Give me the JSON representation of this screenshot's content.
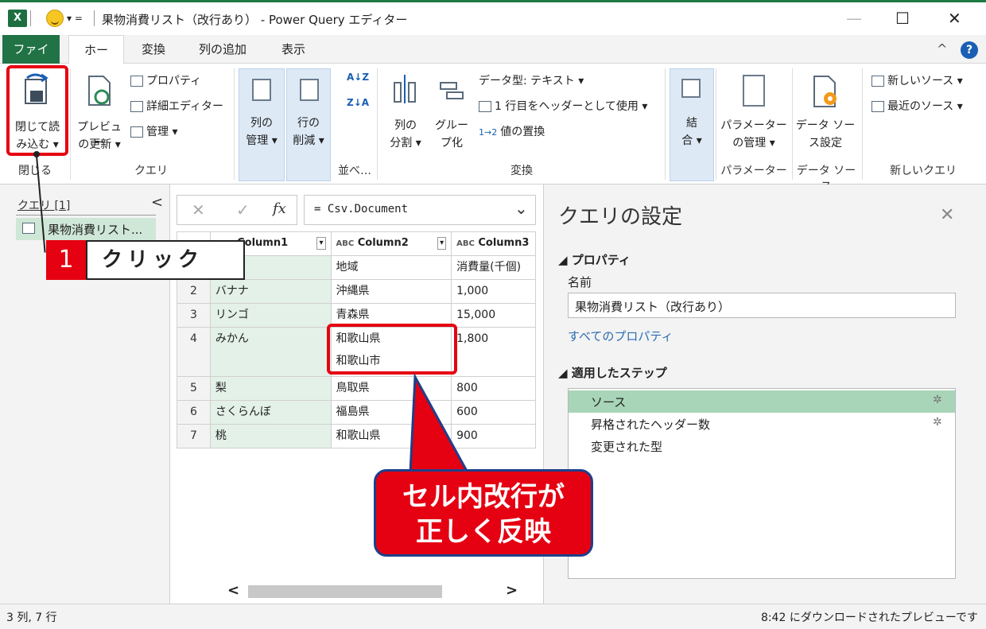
{
  "window": {
    "title": "果物消費リスト（改行あり） - Power Query エディター",
    "close_glyph": "✕",
    "maximize_glyph": "☐",
    "minimize_glyph": "—",
    "qat_arrow": "▾ ="
  },
  "tabs": [
    {
      "label": "ファイル"
    },
    {
      "label": "ホーム"
    },
    {
      "label": "変換"
    },
    {
      "label": "列の追加"
    },
    {
      "label": "表示"
    }
  ],
  "ribbon": {
    "close_load": [
      "閉じて読",
      "み込む ▾"
    ],
    "preview_refresh": [
      "プレビュー",
      "の更新 ▾"
    ],
    "properties": "プロパティ",
    "advanced_editor": "詳細エディター",
    "manage": "管理 ▾",
    "manage_columns": [
      "列の",
      "管理 ▾"
    ],
    "reduce_rows": [
      "行の",
      "削減 ▾"
    ],
    "split_column": [
      "列の",
      "分割 ▾"
    ],
    "group_by": [
      "グルー",
      "プ化"
    ],
    "data_type": "データ型: テキスト ▾",
    "use_first_row": "1 行目をヘッダーとして使用 ▾",
    "replace_values": "値の置換",
    "combine": [
      "結",
      "合 ▾"
    ],
    "manage_params": [
      "パラメーター",
      "の管理 ▾"
    ],
    "data_source_settings": [
      "データ ソー",
      "ス設定"
    ],
    "new_source": "新しいソース ▾",
    "recent_source": "最近のソース ▾",
    "groups": {
      "close": "閉じる",
      "query": "クエリ",
      "sort": "並べ…",
      "transform": "変換",
      "parameters": "パラメーター",
      "data_source": "データ ソース",
      "new_query": "新しいクエリ"
    },
    "sort_az": "A↓Z",
    "sort_za": "Z↓A"
  },
  "left_pane": {
    "header": "クエリ [1]",
    "collapse": "<",
    "query_item": "果物消費リスト..."
  },
  "formula_bar": {
    "cancel": "✕",
    "commit": "✓",
    "fx": "fx",
    "formula": "= Csv.Document",
    "dropdown": "⌄"
  },
  "grid": {
    "headers": [
      "Column1",
      "Column2",
      "Column3"
    ],
    "header_type": "ABC",
    "rows": [
      {
        "n": "1",
        "c1": "",
        "c2": "地域",
        "c3": "消費量(千個)"
      },
      {
        "n": "2",
        "c1": "バナナ",
        "c2": "沖縄県",
        "c3": "1,000"
      },
      {
        "n": "3",
        "c1": "リンゴ",
        "c2": "青森県",
        "c3": "15,000"
      },
      {
        "n": "4",
        "c1": "みかん",
        "c2": "和歌山県",
        "c2b": "和歌山市",
        "c3": "1,800"
      },
      {
        "n": "5",
        "c1": "梨",
        "c2": "鳥取県",
        "c3": "800"
      },
      {
        "n": "6",
        "c1": "さくらんぼ",
        "c2": "福島県",
        "c3": "600"
      },
      {
        "n": "7",
        "c1": "桃",
        "c2": "和歌山県",
        "c3": "900"
      }
    ],
    "scroll_left": "<",
    "scroll_right": ">"
  },
  "right_pane": {
    "title": "クエリの設定",
    "close": "✕",
    "properties_header": "◢ プロパティ",
    "name_label": "名前",
    "name_value": "果物消費リスト（改行あり）",
    "all_properties": "すべてのプロパティ",
    "steps_header": "◢ 適用したステップ",
    "steps": [
      "ソース",
      "昇格されたヘッダー数",
      "変更された型"
    ]
  },
  "status": {
    "left": "3 列, 7 行",
    "right": "8:42 にダウンロードされたプレビューです"
  },
  "callouts": {
    "step_number": "1",
    "step_text": "クリック",
    "bubble_line1": "セル内改行が",
    "bubble_line2": "正しく反映"
  },
  "colors": {
    "excel_green": "#217346",
    "callout_red": "#e50012",
    "selected_step": "#a8d5b8"
  }
}
